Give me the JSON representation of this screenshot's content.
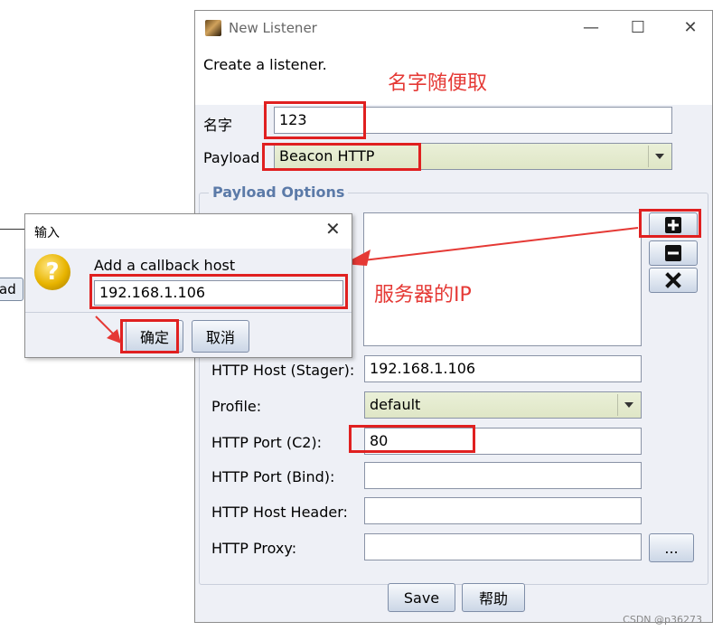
{
  "background": {
    "partial_button_label": "ad"
  },
  "window": {
    "title": "New Listener",
    "header_text": "Create a listener.",
    "name_label": "名字",
    "name_value": "123",
    "payload_label": "Payload",
    "payload_value": "Beacon HTTP",
    "payload_options_legend": "Payload Options",
    "http_host_stager_label": "HTTP Host (Stager):",
    "http_host_stager_value": "192.168.1.106",
    "profile_label": "Profile:",
    "profile_value": "default",
    "http_port_c2_label": "HTTP Port (C2):",
    "http_port_c2_value": "80",
    "http_port_bind_label": "HTTP Port (Bind):",
    "http_port_bind_value": "",
    "http_host_header_label": "HTTP Host Header:",
    "http_host_header_value": "",
    "http_proxy_label": "HTTP Proxy:",
    "http_proxy_value": "",
    "proxy_browse_label": "...",
    "save_label": "Save",
    "help_label": "帮助"
  },
  "dialog": {
    "title": "输入",
    "prompt": "Add a callback host",
    "input_value": "192.168.1.106",
    "ok_label": "确定",
    "cancel_label": "取消"
  },
  "annotations": {
    "name_note": "名字随便取",
    "ip_note": "服务器的IP"
  },
  "watermark": "CSDN @p36273",
  "colors": {
    "annotation_red": "#e02020",
    "legend_blue": "#5b7aa8"
  }
}
